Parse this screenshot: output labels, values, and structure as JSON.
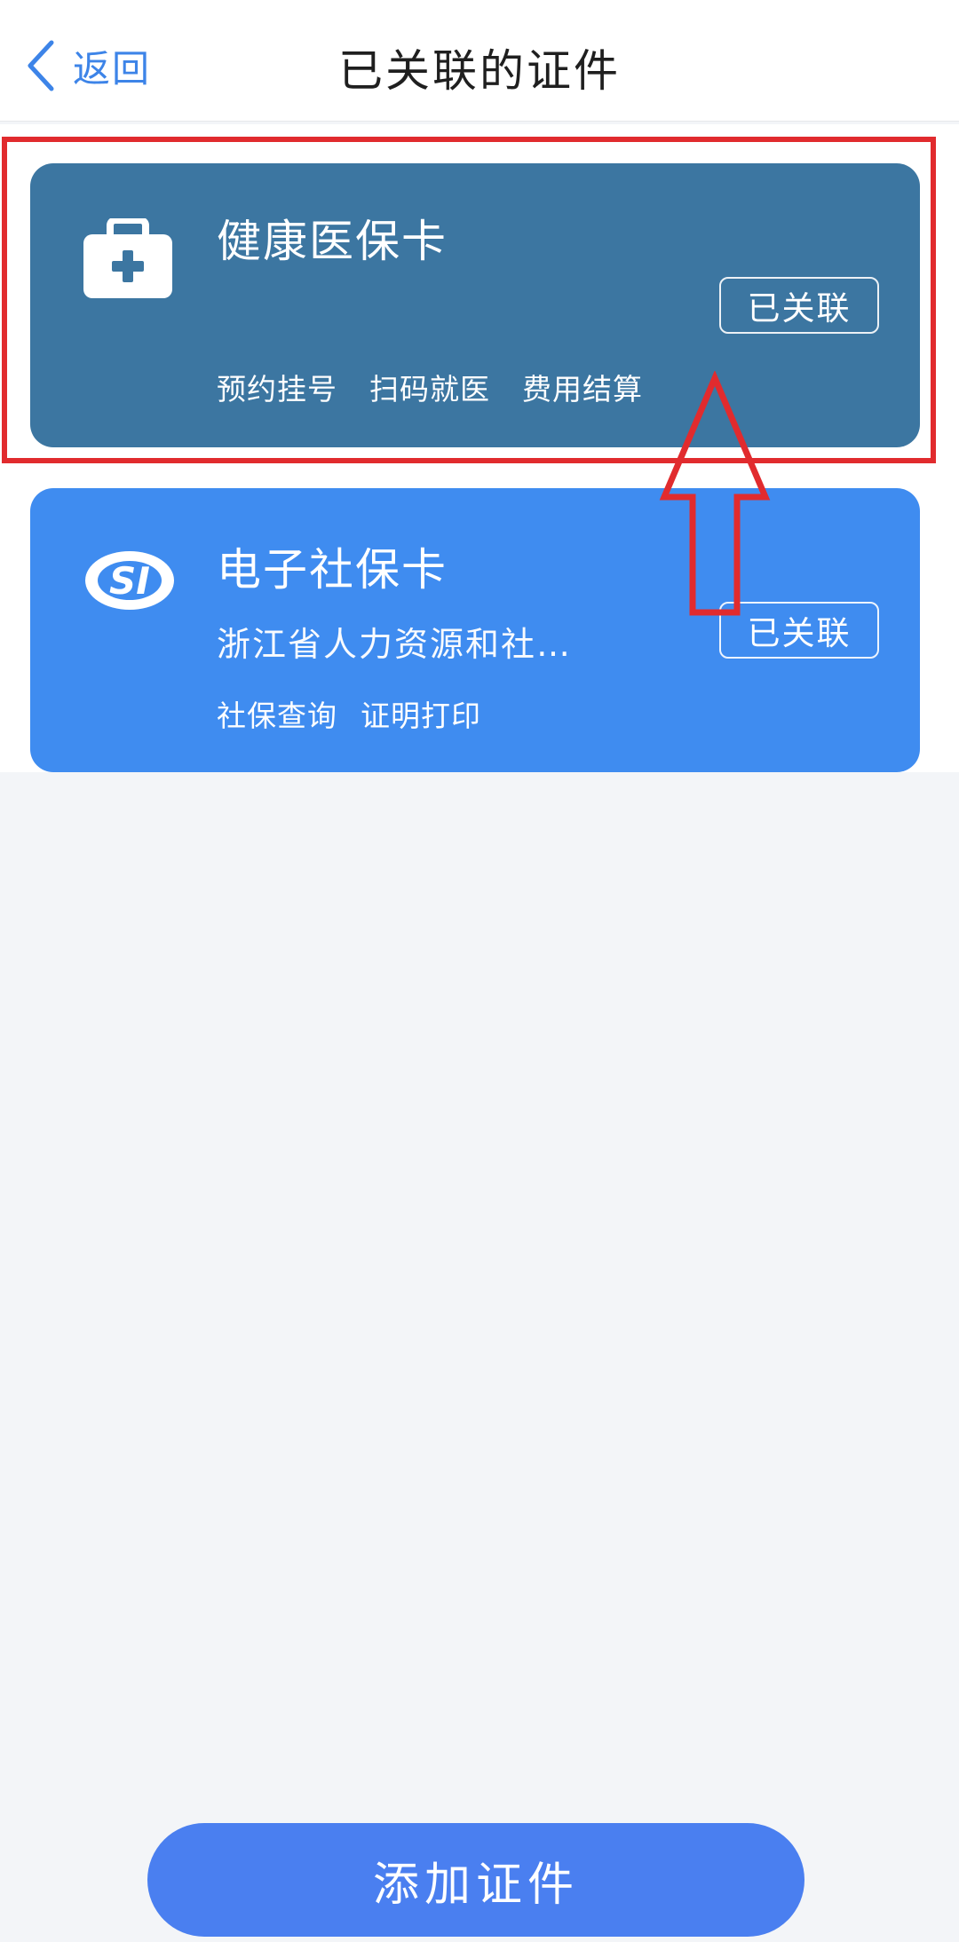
{
  "header": {
    "back_label": "返回",
    "title": "已关联的证件"
  },
  "cards": [
    {
      "name": "健康医保卡",
      "status": "已关联",
      "services": [
        "预约挂号",
        "扫码就医",
        "费用结算"
      ],
      "icon": "medical-kit-icon",
      "color": "#3c76a1"
    },
    {
      "name": "电子社保卡",
      "org": "浙江省人力资源和社…",
      "status": "已关联",
      "services": [
        "社保查询",
        "证明打印"
      ],
      "icon": "si-logo-icon",
      "color": "#3f8cf0"
    }
  ],
  "footer": {
    "add_button_label": "添加证件",
    "button_color": "#4a7ff0"
  },
  "annotations": {
    "highlight_color": "#e12b2e"
  }
}
